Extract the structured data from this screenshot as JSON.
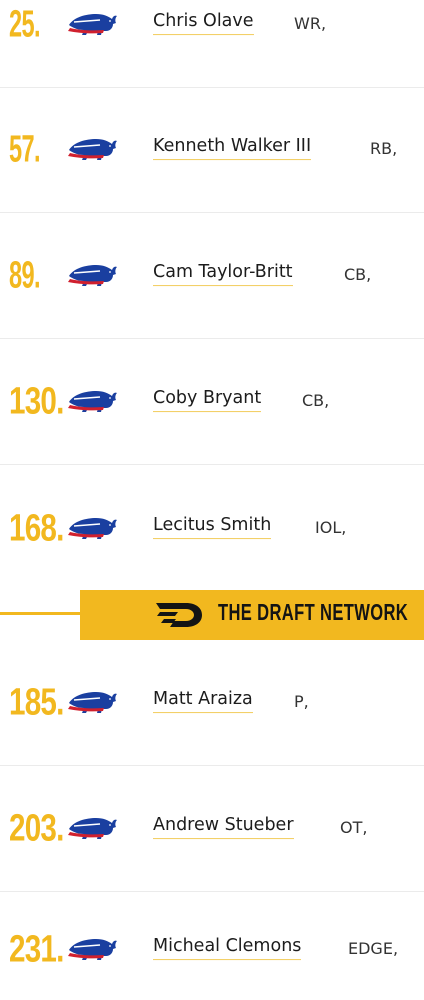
{
  "picks": [
    {
      "pick": "25.",
      "player": "Chris Olave",
      "position": "WR,"
    },
    {
      "pick": "57.",
      "player": "Kenneth Walker III",
      "position": "RB,"
    },
    {
      "pick": "89.",
      "player": "Cam Taylor-Britt",
      "position": "CB,"
    },
    {
      "pick": "130.",
      "player": "Coby Bryant",
      "position": "CB,"
    },
    {
      "pick": "168.",
      "player": "Lecitus Smith",
      "position": "IOL,"
    },
    {
      "pick": "185.",
      "player": "Matt Araiza",
      "position": "P,"
    },
    {
      "pick": "203.",
      "player": "Andrew Stueber",
      "position": "OT,"
    },
    {
      "pick": "231.",
      "player": "Micheal Clemons",
      "position": "EDGE,"
    }
  ],
  "team_logo": "buffalo-bills-logo",
  "banner": {
    "text": "THE DRAFT NETWORK",
    "logo": "draft-network-logo"
  },
  "colors": {
    "accent": "#f2b81f",
    "logo_blue": "#1a3fa0",
    "logo_red": "#d0202e"
  }
}
